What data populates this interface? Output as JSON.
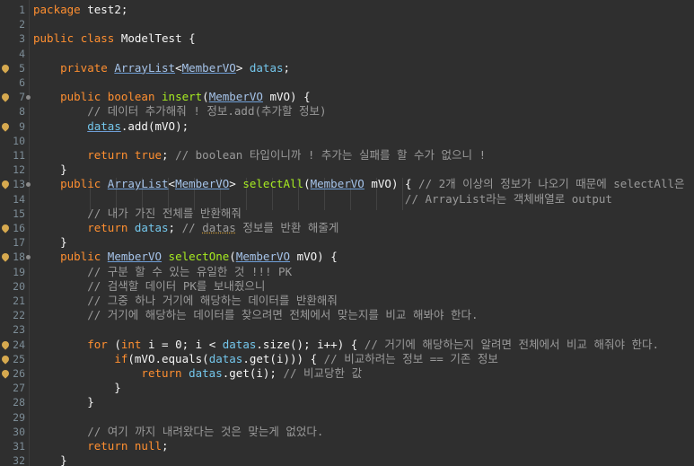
{
  "editor": {
    "lines": [
      {
        "no": "1",
        "t": [
          [
            "kw",
            "package"
          ],
          [
            "p",
            " test2;"
          ]
        ]
      },
      {
        "no": "2",
        "t": []
      },
      {
        "no": "3",
        "t": [
          [
            "kw",
            "public"
          ],
          [
            "p",
            " "
          ],
          [
            "kw",
            "class"
          ],
          [
            "p",
            " "
          ],
          [
            "name",
            "ModelTest"
          ],
          [
            "p",
            " {"
          ]
        ]
      },
      {
        "no": "4",
        "t": []
      },
      {
        "no": "5",
        "marker": true,
        "t": [
          [
            "p",
            "    "
          ],
          [
            "kw",
            "private"
          ],
          [
            "p",
            " "
          ],
          [
            "typ u",
            "ArrayList"
          ],
          [
            "p",
            "<"
          ],
          [
            "typ u",
            "MemberVO"
          ],
          [
            "p",
            "> "
          ],
          [
            "fld",
            "datas"
          ],
          [
            "p",
            ";"
          ]
        ]
      },
      {
        "no": "6",
        "t": []
      },
      {
        "no": "7",
        "marker": true,
        "fold": true,
        "t": [
          [
            "p",
            "    "
          ],
          [
            "kw",
            "public"
          ],
          [
            "p",
            " "
          ],
          [
            "kw",
            "boolean"
          ],
          [
            "p",
            " "
          ],
          [
            "m",
            "insert"
          ],
          [
            "p",
            "("
          ],
          [
            "typ u",
            "MemberVO"
          ],
          [
            "p",
            " "
          ],
          [
            "name",
            "mVO"
          ],
          [
            "p",
            ") {"
          ]
        ]
      },
      {
        "no": "8",
        "t": [
          [
            "cm",
            "        // 데이터 추가해줘 ! 정보.add(추가할 정보)"
          ]
        ]
      },
      {
        "no": "9",
        "marker": true,
        "t": [
          [
            "p",
            "        "
          ],
          [
            "fld u",
            "datas"
          ],
          [
            "p",
            ".add(mVO);"
          ]
        ]
      },
      {
        "no": "10",
        "t": []
      },
      {
        "no": "11",
        "t": [
          [
            "p",
            "        "
          ],
          [
            "kw",
            "return"
          ],
          [
            "p",
            " "
          ],
          [
            "kw",
            "true"
          ],
          [
            "p",
            "; "
          ],
          [
            "cm",
            "// boolean 타입이니까 ! 추가는 실패를 할 수가 없으니 !"
          ]
        ]
      },
      {
        "no": "12",
        "t": [
          [
            "p",
            "    }"
          ]
        ]
      },
      {
        "no": "13",
        "marker": true,
        "fold": true,
        "t": [
          [
            "p",
            "    "
          ],
          [
            "kw",
            "public"
          ],
          [
            "p",
            " "
          ],
          [
            "typ u",
            "ArrayList"
          ],
          [
            "p",
            "<"
          ],
          [
            "typ u",
            "MemberVO"
          ],
          [
            "p",
            "> "
          ],
          [
            "m",
            "selectAll"
          ],
          [
            "p",
            "("
          ],
          [
            "typ u",
            "MemberVO"
          ],
          [
            "p",
            " "
          ],
          [
            "name",
            "mVO"
          ],
          [
            "p",
            ") { "
          ],
          [
            "cm",
            "// 2개 이상의 정보가 나오기 때문에 selectAll은"
          ]
        ]
      },
      {
        "no": "14",
        "t": [
          [
            "p",
            "                                                       "
          ],
          [
            "cm",
            "// ArrayList라는 객체배열로 output"
          ]
        ]
      },
      {
        "no": "15",
        "t": [
          [
            "cm",
            "        // 내가 가진 전체를 반환해줘"
          ]
        ]
      },
      {
        "no": "16",
        "marker": true,
        "t": [
          [
            "p",
            "        "
          ],
          [
            "kw",
            "return"
          ],
          [
            "p",
            " "
          ],
          [
            "fld",
            "datas"
          ],
          [
            "p",
            "; "
          ],
          [
            "cm",
            "// "
          ],
          [
            "cm uu",
            "datas"
          ],
          [
            "cm",
            " 정보를 반환 해줄게"
          ]
        ]
      },
      {
        "no": "17",
        "t": [
          [
            "p",
            "    }"
          ]
        ]
      },
      {
        "no": "18",
        "marker": true,
        "fold": true,
        "t": [
          [
            "p",
            "    "
          ],
          [
            "kw",
            "public"
          ],
          [
            "p",
            " "
          ],
          [
            "typ u",
            "MemberVO"
          ],
          [
            "p",
            " "
          ],
          [
            "m",
            "selectOne"
          ],
          [
            "p",
            "("
          ],
          [
            "typ u",
            "MemberVO"
          ],
          [
            "p",
            " "
          ],
          [
            "name",
            "mVO"
          ],
          [
            "p",
            ") {"
          ]
        ]
      },
      {
        "no": "19",
        "t": [
          [
            "cm",
            "        // 구분 할 수 있는 유일한 것 !!! PK"
          ]
        ]
      },
      {
        "no": "20",
        "t": [
          [
            "cm",
            "        // 검색할 데이터 PK를 보내줬으니"
          ]
        ]
      },
      {
        "no": "21",
        "t": [
          [
            "cm",
            "        // 그중 하나 거기에 해당하는 데이터를 반환해줘"
          ]
        ]
      },
      {
        "no": "22",
        "t": [
          [
            "cm",
            "        // 거기에 해당하는 데이터를 찾으려면 전체에서 맞는지를 비교 해봐야 한다."
          ]
        ]
      },
      {
        "no": "23",
        "t": []
      },
      {
        "no": "24",
        "marker": true,
        "t": [
          [
            "p",
            "        "
          ],
          [
            "kw",
            "for"
          ],
          [
            "p",
            " ("
          ],
          [
            "kw",
            "int"
          ],
          [
            "p",
            " i = 0; i < "
          ],
          [
            "fld",
            "datas"
          ],
          [
            "p",
            ".size(); i++) { "
          ],
          [
            "cm",
            "// 거기에 해당하는지 알려면 전체에서 비교 해줘야 한다."
          ]
        ]
      },
      {
        "no": "25",
        "marker": true,
        "t": [
          [
            "p",
            "            "
          ],
          [
            "kw",
            "if"
          ],
          [
            "p",
            "(mVO.equals("
          ],
          [
            "fld",
            "datas"
          ],
          [
            "p",
            ".get(i))) { "
          ],
          [
            "cm",
            "// 비교하려는 정보 == 기존 정보"
          ]
        ]
      },
      {
        "no": "26",
        "marker": true,
        "t": [
          [
            "p",
            "                "
          ],
          [
            "kw",
            "return"
          ],
          [
            "p",
            " "
          ],
          [
            "fld",
            "datas"
          ],
          [
            "p",
            ".get(i); "
          ],
          [
            "cm",
            "// 비교당한 값"
          ]
        ]
      },
      {
        "no": "27",
        "t": [
          [
            "p",
            "            }"
          ]
        ]
      },
      {
        "no": "28",
        "t": [
          [
            "p",
            "        }"
          ]
        ]
      },
      {
        "no": "29",
        "t": []
      },
      {
        "no": "30",
        "t": [
          [
            "cm",
            "        // 여기 까지 내려왔다는 것은 맞는게 없었다."
          ]
        ]
      },
      {
        "no": "31",
        "t": [
          [
            "p",
            "        "
          ],
          [
            "kw",
            "return"
          ],
          [
            "p",
            " "
          ],
          [
            "kw",
            "null"
          ],
          [
            "p",
            ";"
          ]
        ]
      },
      {
        "no": "32",
        "t": [
          [
            "p",
            "    }"
          ]
        ]
      }
    ]
  }
}
